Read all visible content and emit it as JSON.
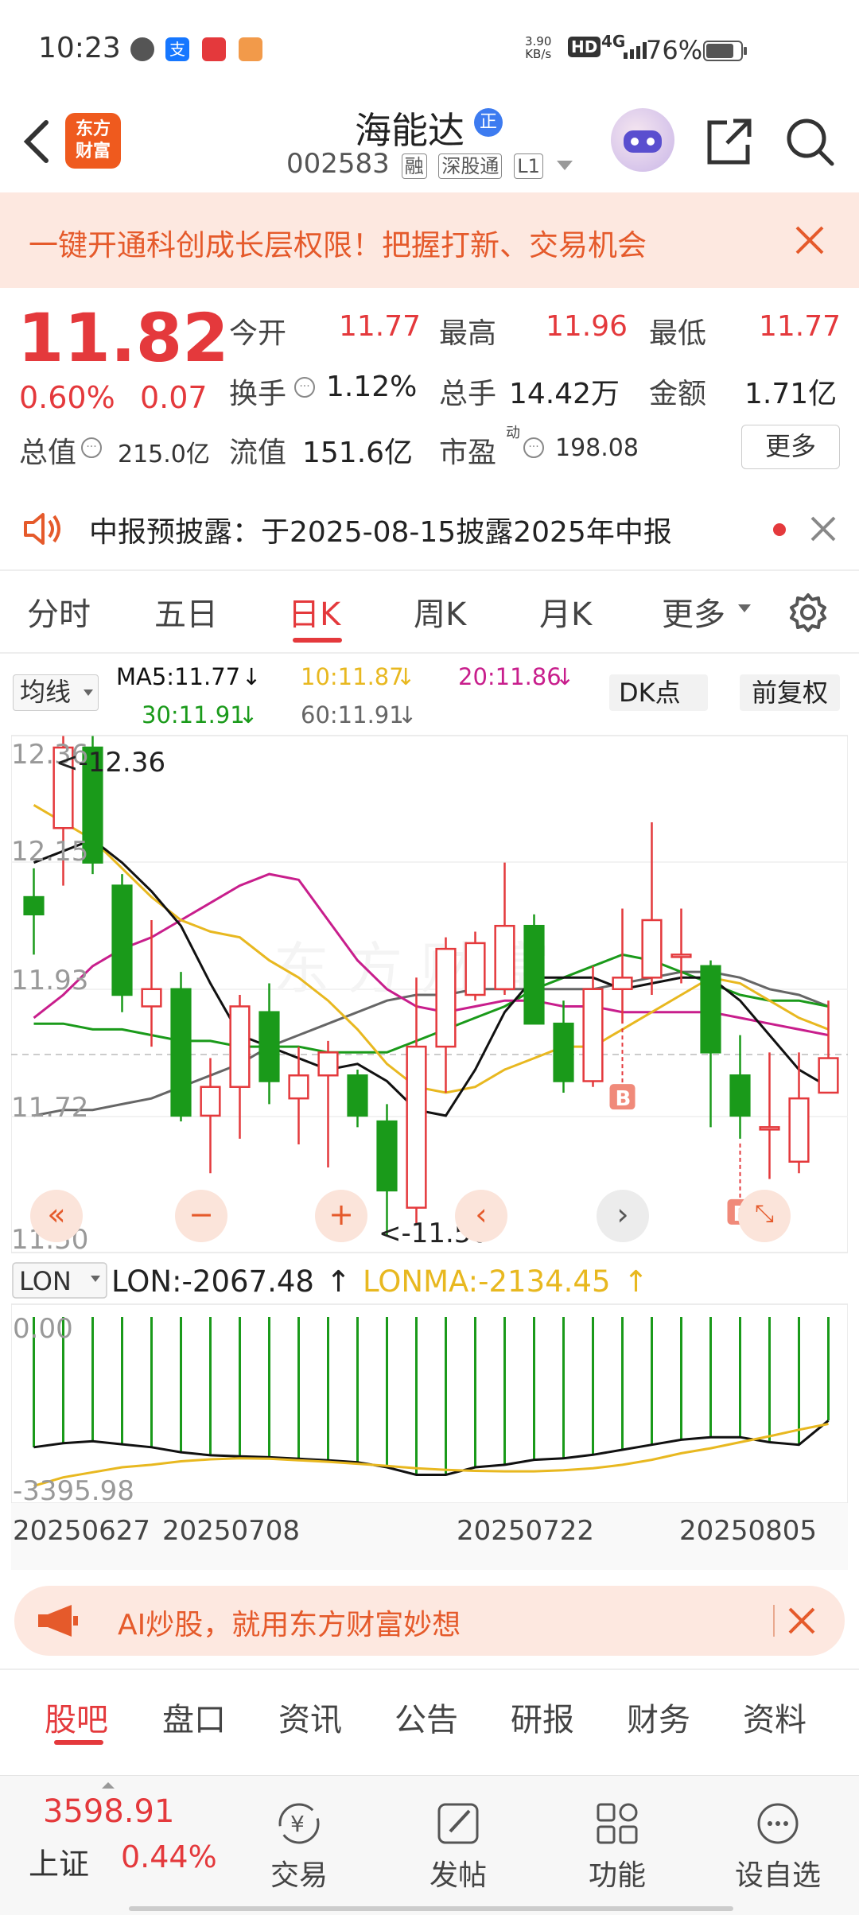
{
  "status_bar": {
    "time": "10:23",
    "net_speed_value": "3.90",
    "net_speed_unit": "KB/s",
    "hd": "HD",
    "signal": "4G",
    "battery": "76%"
  },
  "header": {
    "logo_text": "东方财富",
    "stock_name": "海能达",
    "badge": "正",
    "stock_code": "002583",
    "tags": [
      "融",
      "深股通",
      "L1"
    ]
  },
  "banner": {
    "text": "一键开通科创成长层权限！把握打新、交易机会"
  },
  "quote": {
    "price": "11.82",
    "change_pct": "0.60%",
    "change": "0.07",
    "total_value_label": "总值",
    "total_value": "215.0亿",
    "rows": [
      [
        {
          "label": "今开",
          "value": "11.77",
          "color": "red"
        },
        {
          "label": "最高",
          "value": "11.96",
          "color": "red"
        },
        {
          "label": "最低",
          "value": "11.77",
          "color": "red"
        }
      ],
      [
        {
          "label": "换手",
          "value": "1.12%",
          "color": "normal"
        },
        {
          "label": "总手",
          "value": "14.42万",
          "color": "normal"
        },
        {
          "label": "金额",
          "value": "1.71亿",
          "color": "normal"
        }
      ],
      [
        {
          "label": "流值",
          "value": "151.6亿",
          "color": "normal"
        },
        {
          "label": "市盈",
          "value": "198.08",
          "color": "normal"
        }
      ]
    ],
    "pe_superscript": "动",
    "more_button": "更多"
  },
  "notice": {
    "text": "中报预披露：于2025-08-15披露2025年中报"
  },
  "chart_tabs": [
    "分时",
    "五日",
    "日K",
    "周K",
    "月K",
    "更多"
  ],
  "active_chart_tab": "日K",
  "ma_bar": {
    "selector": "均线",
    "ma5": "MA5:11.77",
    "ma10": "10:11.87",
    "ma20": "20:11.86",
    "ma30": "30:11.91",
    "ma60": "60:11.91",
    "dk_button": "DK点",
    "fq_button": "前复权"
  },
  "kline": {
    "y_labels": [
      "12.36",
      "12.15",
      "11.93",
      "11.72",
      "11.50"
    ],
    "max_label": "<-12.36",
    "min_label": "<-11.50",
    "buy_marker": "B"
  },
  "lon": {
    "selector": "LON",
    "lon_value": "LON:-2067.48",
    "lonma_value": "LONMA:-2134.45",
    "y_top": "0.00",
    "y_bottom": "-3395.98"
  },
  "x_dates": [
    "20250627",
    "20250708",
    "20250722",
    "20250805"
  ],
  "chart_data": {
    "type": "candlestick",
    "ylim": [
      11.5,
      12.36
    ],
    "candles": [
      {
        "o": 12.1,
        "c": 12.07,
        "h": 12.15,
        "l": 12.0
      },
      {
        "o": 12.22,
        "c": 12.36,
        "h": 12.38,
        "l": 12.12
      },
      {
        "o": 12.36,
        "c": 12.16,
        "h": 12.38,
        "l": 12.14
      },
      {
        "o": 12.12,
        "c": 11.93,
        "h": 12.14,
        "l": 11.9
      },
      {
        "o": 11.91,
        "c": 11.94,
        "h": 12.06,
        "l": 11.84
      },
      {
        "o": 11.94,
        "c": 11.72,
        "h": 11.97,
        "l": 11.71
      },
      {
        "o": 11.72,
        "c": 11.77,
        "h": 11.82,
        "l": 11.62
      },
      {
        "o": 11.77,
        "c": 11.91,
        "h": 11.93,
        "l": 11.68
      },
      {
        "o": 11.9,
        "c": 11.78,
        "h": 11.95,
        "l": 11.74
      },
      {
        "o": 11.75,
        "c": 11.79,
        "h": 11.84,
        "l": 11.67
      },
      {
        "o": 11.79,
        "c": 11.83,
        "h": 11.85,
        "l": 11.63
      },
      {
        "o": 11.79,
        "c": 11.72,
        "h": 11.8,
        "l": 11.7
      },
      {
        "o": 11.71,
        "c": 11.59,
        "h": 11.74,
        "l": 11.51
      },
      {
        "o": 11.56,
        "c": 11.84,
        "h": 11.96,
        "l": 11.53
      },
      {
        "o": 11.84,
        "c": 12.01,
        "h": 12.03,
        "l": 11.76
      },
      {
        "o": 11.93,
        "c": 12.02,
        "h": 12.04,
        "l": 11.92
      },
      {
        "o": 11.94,
        "c": 12.05,
        "h": 12.16,
        "l": 11.93
      },
      {
        "o": 12.05,
        "c": 11.88,
        "h": 12.07,
        "l": 11.88
      },
      {
        "o": 11.88,
        "c": 11.78,
        "h": 11.92,
        "l": 11.76
      },
      {
        "o": 11.78,
        "c": 11.94,
        "h": 11.98,
        "l": 11.77
      },
      {
        "o": 11.94,
        "c": 11.96,
        "h": 12.08,
        "l": 11.88
      },
      {
        "o": 11.96,
        "c": 12.06,
        "h": 12.23,
        "l": 11.93
      },
      {
        "o": 12.0,
        "c": 12.0,
        "h": 12.08,
        "l": 11.95
      },
      {
        "o": 11.98,
        "c": 11.83,
        "h": 11.99,
        "l": 11.7
      },
      {
        "o": 11.79,
        "c": 11.72,
        "h": 11.86,
        "l": 11.68
      },
      {
        "o": 11.7,
        "c": 11.7,
        "h": 11.83,
        "l": 11.61
      },
      {
        "o": 11.64,
        "c": 11.75,
        "h": 11.83,
        "l": 11.62
      },
      {
        "o": 11.76,
        "c": 11.82,
        "h": 11.92,
        "l": 11.76
      }
    ],
    "ma5": [
      12.16,
      12.18,
      12.2,
      12.16,
      12.11,
      12.05,
      11.95,
      11.86,
      11.84,
      11.82,
      11.8,
      11.81,
      11.78,
      11.73,
      11.72,
      11.8,
      11.9,
      11.96,
      11.96,
      11.96,
      11.94,
      11.95,
      11.96,
      11.96,
      11.92,
      11.86,
      11.8,
      11.77
    ],
    "ma10": [
      12.26,
      12.23,
      12.2,
      12.15,
      12.1,
      12.06,
      12.04,
      12.03,
      11.99,
      11.96,
      11.92,
      11.87,
      11.81,
      11.77,
      11.76,
      11.77,
      11.8,
      11.82,
      11.84,
      11.84,
      11.87,
      11.9,
      11.93,
      11.96,
      11.95,
      11.92,
      11.89,
      11.87
    ],
    "ma20": [
      11.89,
      11.93,
      11.98,
      12.01,
      12.03,
      12.06,
      12.09,
      12.12,
      12.14,
      12.13,
      12.06,
      11.99,
      11.94,
      11.91,
      11.9,
      11.91,
      11.92,
      11.92,
      11.91,
      11.91,
      11.9,
      11.9,
      11.9,
      11.9,
      11.89,
      11.88,
      11.87,
      11.86
    ],
    "ma30": [
      11.88,
      11.88,
      11.87,
      11.87,
      11.86,
      11.85,
      11.85,
      11.84,
      11.84,
      11.84,
      11.83,
      11.83,
      11.83,
      11.85,
      11.87,
      11.89,
      11.91,
      11.94,
      11.96,
      11.98,
      12.0,
      11.99,
      11.97,
      11.95,
      11.93,
      11.92,
      11.92,
      11.91
    ],
    "ma60": [
      11.72,
      11.73,
      11.73,
      11.74,
      11.75,
      11.77,
      11.79,
      11.81,
      11.84,
      11.86,
      11.88,
      11.9,
      11.92,
      11.93,
      11.93,
      11.94,
      11.94,
      11.94,
      11.94,
      11.94,
      11.95,
      11.96,
      11.97,
      11.97,
      11.96,
      11.94,
      11.93,
      11.91
    ],
    "buy_signals": [
      20,
      24
    ],
    "lon_ylim": [
      -3395.98,
      0
    ],
    "lon": [
      -2600,
      -2520,
      -2480,
      -2540,
      -2600,
      -2700,
      -2760,
      -2780,
      -2800,
      -2830,
      -2860,
      -2900,
      -3000,
      -3150,
      -3150,
      -3000,
      -2950,
      -2850,
      -2820,
      -2750,
      -2650,
      -2550,
      -2450,
      -2400,
      -2400,
      -2500,
      -2550,
      -2067
    ],
    "lonma": [
      -3370,
      -3200,
      -3100,
      -3000,
      -2950,
      -2880,
      -2840,
      -2820,
      -2830,
      -2860,
      -2890,
      -2930,
      -2970,
      -3020,
      -3050,
      -3070,
      -3080,
      -3080,
      -3060,
      -3020,
      -2950,
      -2850,
      -2720,
      -2620,
      -2500,
      -2380,
      -2250,
      -2134
    ]
  },
  "ai_bar": {
    "text": "AI炒股，就用东方财富妙想"
  },
  "bottom_tabs": [
    "股吧",
    "盘口",
    "资讯",
    "公告",
    "研报",
    "财务",
    "资料"
  ],
  "active_bottom_tab": "股吧",
  "bottom_bar": {
    "index_value": "3598.91",
    "index_name": "上证",
    "index_change": "0.44%",
    "items": [
      "交易",
      "发帖",
      "功能",
      "设自选"
    ]
  },
  "colors": {
    "up": "#e4393c",
    "down": "#1a9a1a",
    "ma5": "#111111",
    "ma10": "#e8b820",
    "ma20": "#c81e8c",
    "ma30": "#1a9a1a",
    "ma60": "#666666",
    "accent": "#ef5a1e"
  }
}
